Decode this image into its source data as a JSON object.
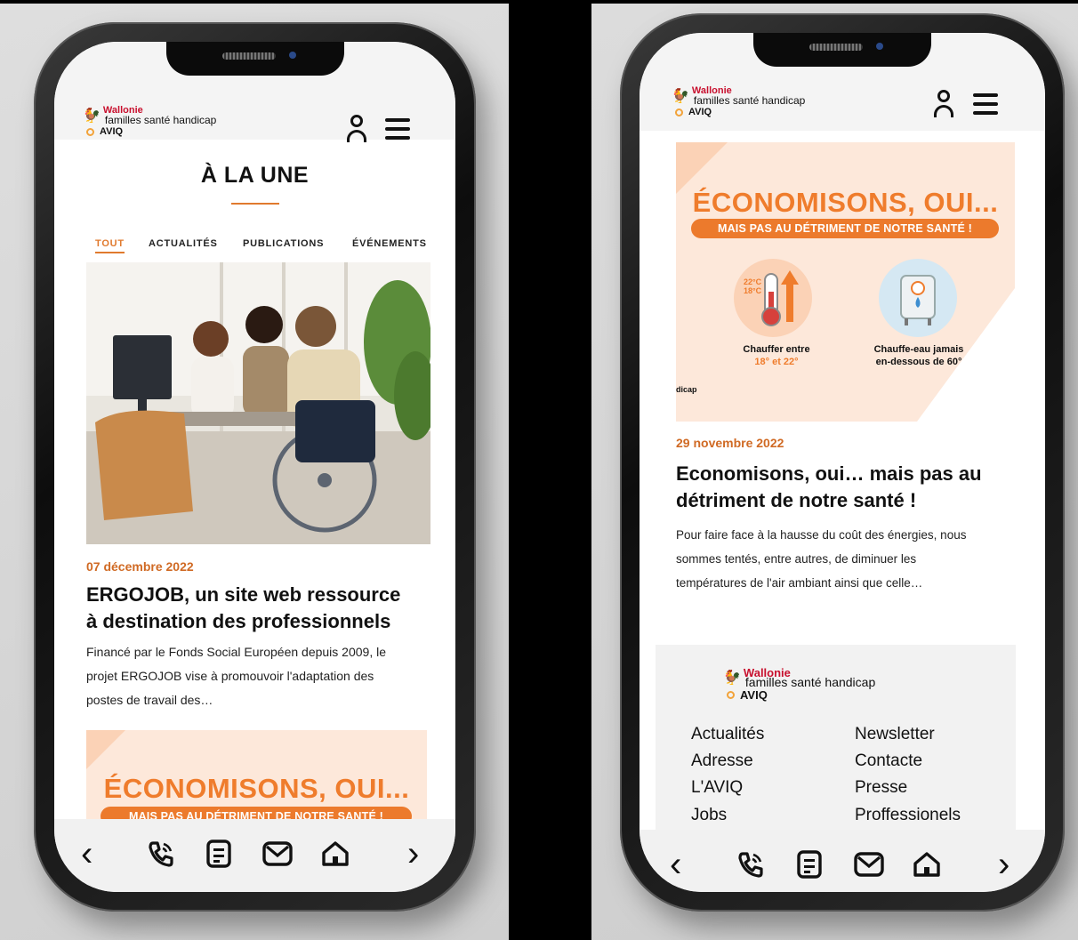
{
  "brand": {
    "wallonie": "Wallonie",
    "subtitle": "familles santé handicap",
    "aviq": "AVIQ"
  },
  "left": {
    "section_title": "À LA UNE",
    "tabs": [
      "TOUT",
      "ACTUALITÉS",
      "PUBLICATIONS",
      "ÉVÉNEMENTS"
    ],
    "article": {
      "date": "07 décembre 2022",
      "title_line1": "ERGOJOB, un site web ressource",
      "title_line2": "à destination des professionnels",
      "excerpt_line1": "Financé par le Fonds Social Européen depuis 2009, le",
      "excerpt_line2": "projet ERGOJOB vise à promouvoir l'adaptation des",
      "excerpt_line3": "postes de travail des…"
    },
    "promo": {
      "title": "ÉCONOMISONS, OUI...",
      "subtitle": "MAIS PAS AU DÉTRIMENT DE NOTRE SANTÉ !"
    }
  },
  "right": {
    "promo": {
      "title": "ÉCONOMISONS, OUI...",
      "subtitle": "MAIS PAS AU DÉTRIMENT DE NOTRE SANTÉ !",
      "temp_labels": [
        "22°C",
        "18°C"
      ],
      "item1_line1": "Chauffer entre",
      "item1_line2": "18° et 22°",
      "item2_line1": "Chauffe-eau jamais",
      "item2_line2": "en-dessous de 60°",
      "cropped_text": "dicap"
    },
    "article": {
      "date": "29 novembre 2022",
      "title_line1": "Economisons, oui… mais pas au",
      "title_line2": "détriment de notre santé !",
      "excerpt_line1": "Pour faire face à la hausse du coût des énergies, nous",
      "excerpt_line2": "sommes tentés, entre autres, de diminuer les",
      "excerpt_line3": "températures de l'air ambiant ainsi que celle…"
    },
    "footer_links_left": [
      "Actualités",
      "Adresse",
      "L'AVIQ",
      "Jobs"
    ],
    "footer_links_right": [
      "Newsletter",
      "Contacte",
      "Presse",
      "Proffessionels"
    ]
  },
  "bottom_nav": [
    "chevron-left-icon",
    "phone-icon",
    "document-icon",
    "mail-icon",
    "home-icon",
    "chevron-right-icon"
  ],
  "colors": {
    "accent": "#e07a2e",
    "promo_bg": "#fde8da",
    "wallonie_red": "#c8102e"
  }
}
